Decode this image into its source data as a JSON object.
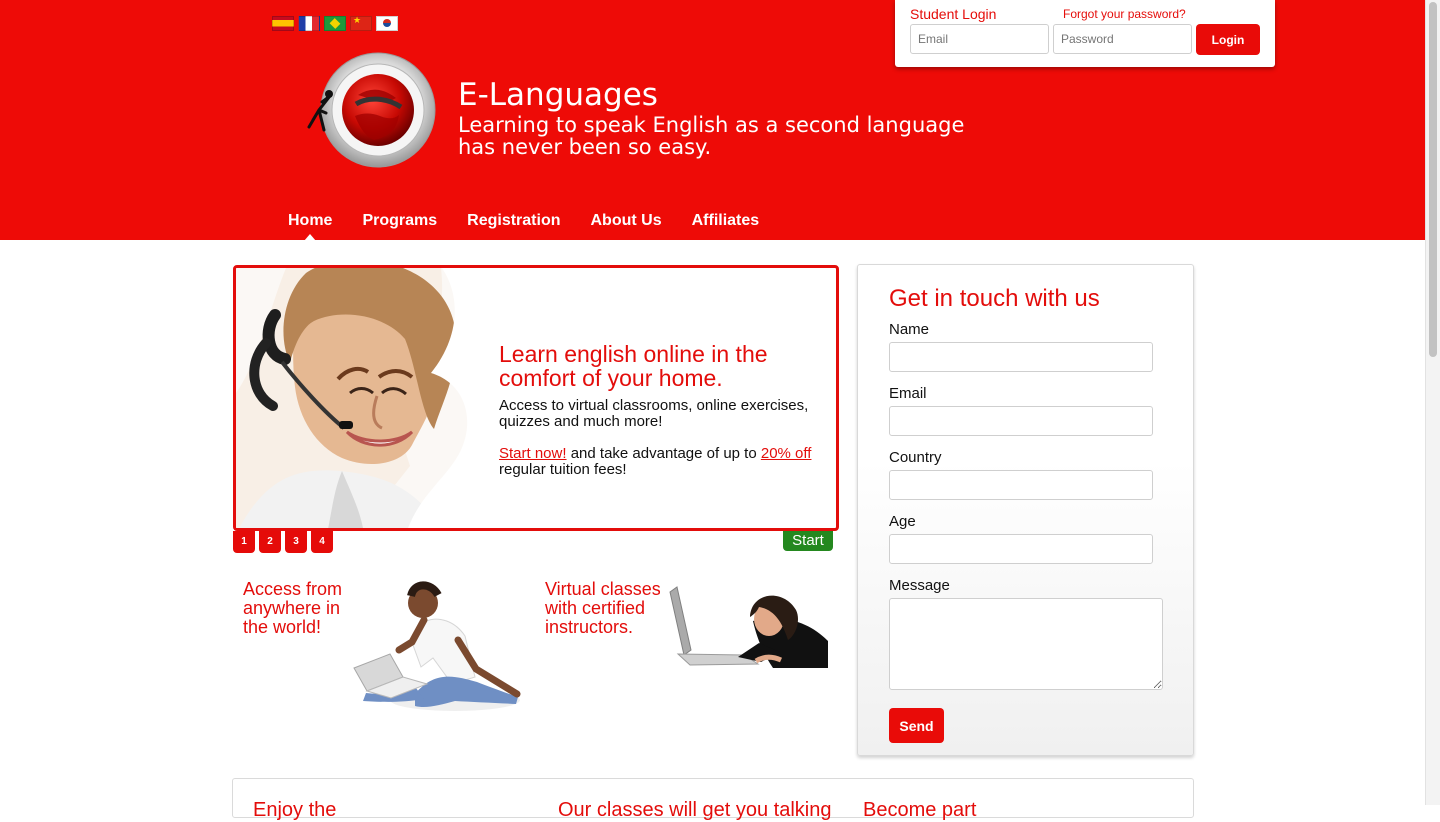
{
  "header": {
    "brand_title": "E-Languages",
    "brand_subtitle": "Learning to speak English as a second language has never been so easy."
  },
  "login": {
    "title": "Student Login",
    "forgot": "Forgot your password?",
    "email_placeholder": "Email",
    "password_placeholder": "Password",
    "button": "Login"
  },
  "nav": {
    "items": [
      "Home",
      "Programs",
      "Registration",
      "About Us",
      "Affiliates"
    ]
  },
  "slider": {
    "heading": "Learn english online in the comfort of your home.",
    "body": "Access to virtual classrooms, online exercises, quizzes and much more!",
    "offer_link1": "Start now!",
    "offer_text1": "and take advantage of up to",
    "offer_link2": "20% off",
    "offer_text2": "regular tuition fees!",
    "pages": [
      "1",
      "2",
      "3",
      "4"
    ],
    "start": "Start"
  },
  "promos": {
    "first": "Access from anywhere in the world!",
    "second": "Virtual classes with certified instructors."
  },
  "contact": {
    "title": "Get in touch with us",
    "labels": {
      "name": "Name",
      "email": "Email",
      "country": "Country",
      "age": "Age",
      "message": "Message"
    },
    "button": "Send"
  },
  "bottom": {
    "text1": "Enjoy the",
    "text2": "Our classes will get you talking",
    "text3": "Become part"
  },
  "colors": {
    "brand_red": "#ee0b07",
    "white": "#ffffff",
    "green": "#24881f"
  }
}
